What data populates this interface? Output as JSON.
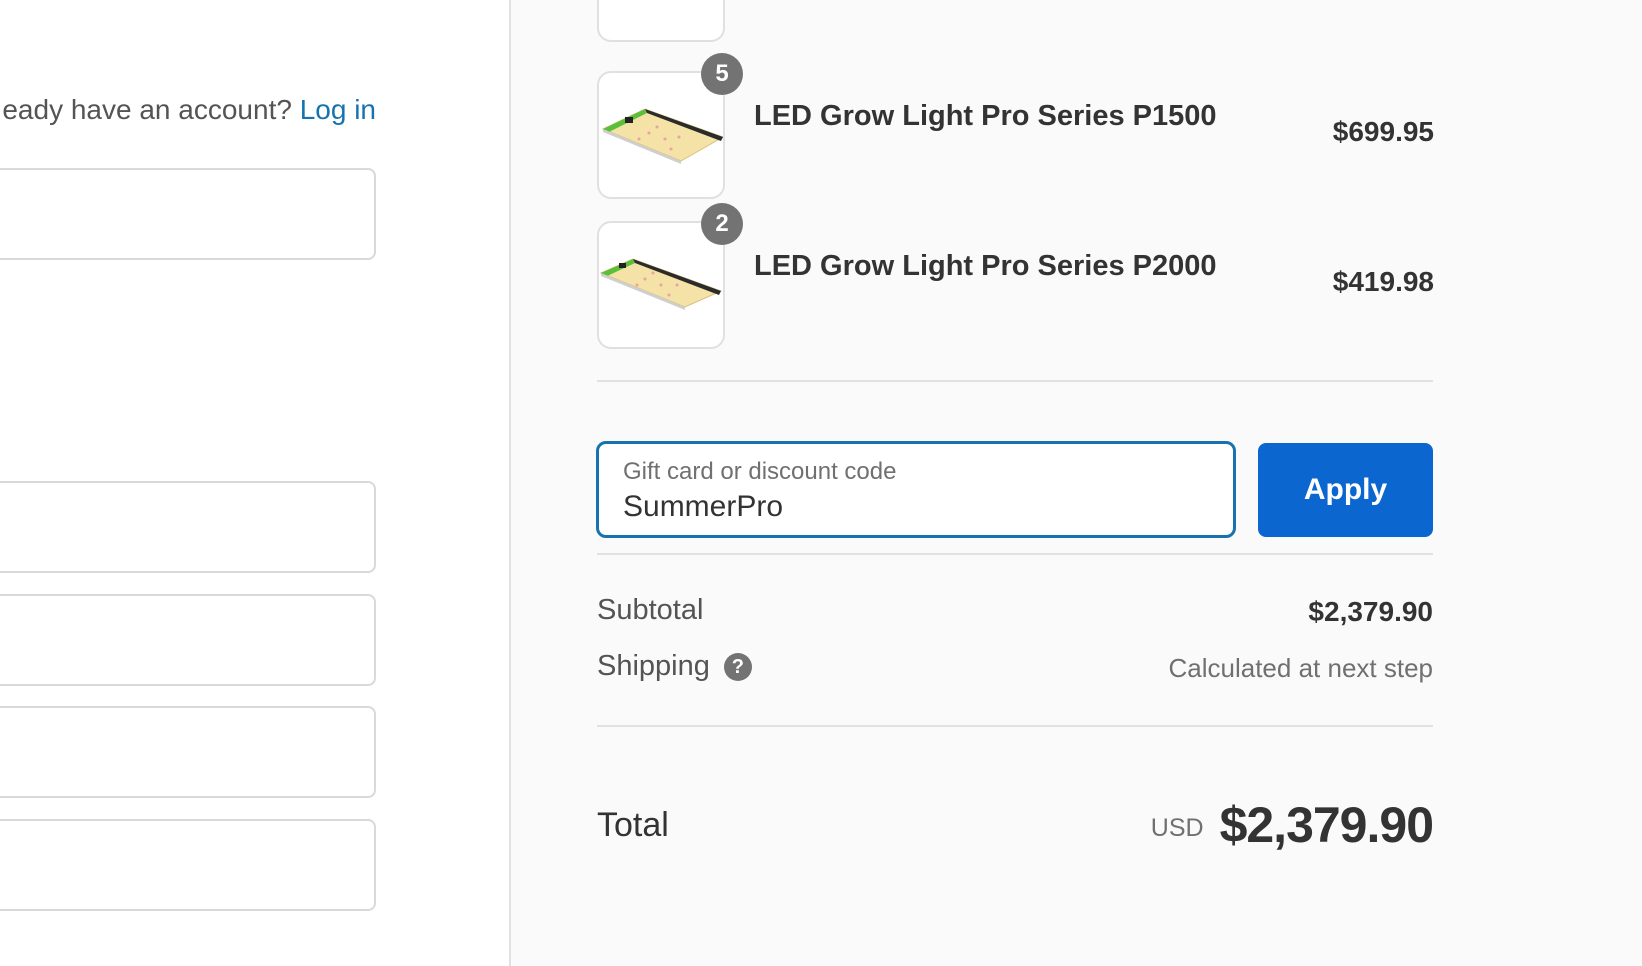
{
  "account": {
    "prompt": "eady have an account?",
    "login_link": "Log in"
  },
  "cart": {
    "items": [
      {
        "name": "LED Grow Light Pro Series P1500",
        "price": "$699.95",
        "quantity": "5",
        "image": "grow-light-panel-icon"
      },
      {
        "name": "LED Grow Light Pro Series P2000",
        "price": "$419.98",
        "quantity": "2",
        "image": "grow-light-panel-icon"
      }
    ]
  },
  "discount": {
    "label": "Gift card or discount code",
    "value": "SummerPro",
    "apply_label": "Apply"
  },
  "summary": {
    "subtotal_label": "Subtotal",
    "subtotal_value": "$2,379.90",
    "shipping_label": "Shipping",
    "shipping_help": "?",
    "shipping_value": "Calculated at next step",
    "total_label": "Total",
    "total_currency": "USD",
    "total_value": "$2,379.90"
  },
  "colors": {
    "accent": "#0b66cf",
    "link": "#1773b0",
    "summary_bg": "#fafafa",
    "badge": "#737373"
  }
}
